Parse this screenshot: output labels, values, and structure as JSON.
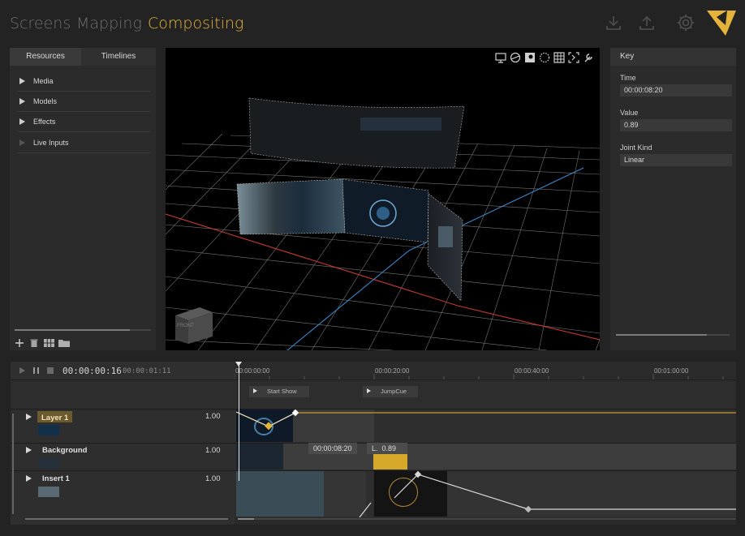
{
  "header": {
    "tabs": [
      {
        "label": "Screens",
        "active": false
      },
      {
        "label": "Mapping",
        "active": false
      },
      {
        "label": "Compositing",
        "active": true
      }
    ],
    "icons": [
      "download-icon",
      "upload-icon",
      "gear-icon",
      "logo"
    ],
    "accent": "#e6b33a"
  },
  "left_panel": {
    "tabs": [
      "Resources",
      "Timelines"
    ],
    "active_tab": "Resources",
    "items": [
      {
        "label": "Media"
      },
      {
        "label": "Models"
      },
      {
        "label": "Effects"
      },
      {
        "label": "Live Inputs"
      }
    ],
    "footer_icons": [
      "add-icon",
      "trash-icon",
      "grid-view-icon",
      "folder-icon"
    ]
  },
  "viewport": {
    "toolbar_icons": [
      "screen-icon",
      "sphere-icon",
      "texture-icon",
      "dotted-circle-icon",
      "grid-icon",
      "frame-icon",
      "wrench-icon"
    ],
    "view_cube_label": "FRONT"
  },
  "right_panel": {
    "title": "Key",
    "time_label": "Time",
    "time_value": "00:00:08:20",
    "value_label": "Value",
    "value_value": "0.89",
    "joint_label": "Joint Kind",
    "joint_value": "Linear"
  },
  "timeline": {
    "current_time": "00:00:00:16",
    "duration": "00:00:01:11",
    "ruler_labels": [
      "00:00:00:00",
      "00:00:20:00",
      "00:00:40:00",
      "00:01:00:00"
    ],
    "cues": [
      {
        "label": "Start Show"
      },
      {
        "label": "JumpCue"
      }
    ],
    "tracks": [
      {
        "name": "Layer 1",
        "value": "1.00",
        "selected": true
      },
      {
        "name": "Background",
        "value": "1.00",
        "selected": false
      },
      {
        "name": "Insert 1",
        "value": "1.00",
        "selected": false
      }
    ],
    "tooltip_time": "00:00:08:20",
    "tooltip_kind": "L.",
    "tooltip_value": "0.89"
  }
}
